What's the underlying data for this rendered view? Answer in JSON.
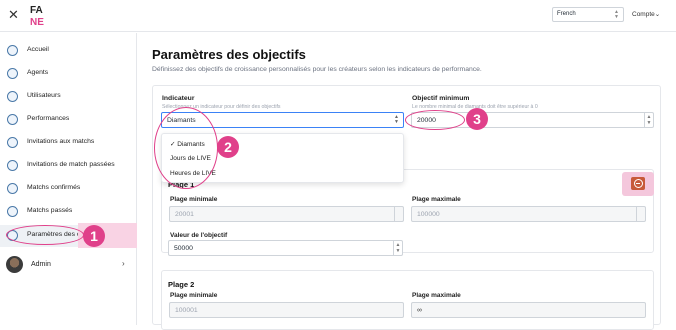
{
  "topbar": {
    "logo_text": "FA",
    "language": "French",
    "account": "Compte"
  },
  "sidebar": {
    "items": [
      {
        "label": "Accueil",
        "icon": "home-icon"
      },
      {
        "label": "Agents",
        "icon": "user-icon"
      },
      {
        "label": "Utilisateurs",
        "icon": "user-icon"
      },
      {
        "label": "Performances",
        "icon": "chart-icon"
      },
      {
        "label": "Invitations aux matchs",
        "icon": "match-icon"
      },
      {
        "label": "Invitations de match passées",
        "icon": "match-icon"
      },
      {
        "label": "Matchs confirmés",
        "icon": "match-icon"
      },
      {
        "label": "Matchs passés",
        "icon": "match-icon"
      },
      {
        "label": "Paramètres des o",
        "icon": "gear-icon"
      }
    ],
    "admin": "Admin"
  },
  "main": {
    "title": "Paramètres des objectifs",
    "subtitle": "Définissez des objectifs de croissance personnalisés pour les créateurs selon les indicateurs de performance."
  },
  "form": {
    "indicator_label": "Indicateur",
    "indicator_help": "Sélectionnez un indicateur pour définir des objectifs",
    "indicator_value": "Diamants",
    "indicator_options": [
      "Diamants",
      "Jours de LIVE",
      "Heures de LIVE"
    ],
    "min_objective_label": "Objectif minimum",
    "min_objective_help": "Le nombre minimal de diamants doit être supérieur à 0",
    "min_objective_value": "20000"
  },
  "plages": [
    {
      "title": "Plage 1",
      "min_label": "Plage minimale",
      "min_value": "20001",
      "max_label": "Plage maximale",
      "max_value": "100000",
      "objective_label": "Valeur de l'objectif",
      "objective_value": "50000"
    },
    {
      "title": "Plage 2",
      "min_label": "Plage minimale",
      "min_value": "100001",
      "max_label": "Plage maximale",
      "max_value": "∞"
    }
  ],
  "annotations": [
    "1",
    "2",
    "3"
  ],
  "colors": {
    "annotation": "#e0408a",
    "remove_button": "#c75a3a",
    "focus": "#3b82f6"
  }
}
